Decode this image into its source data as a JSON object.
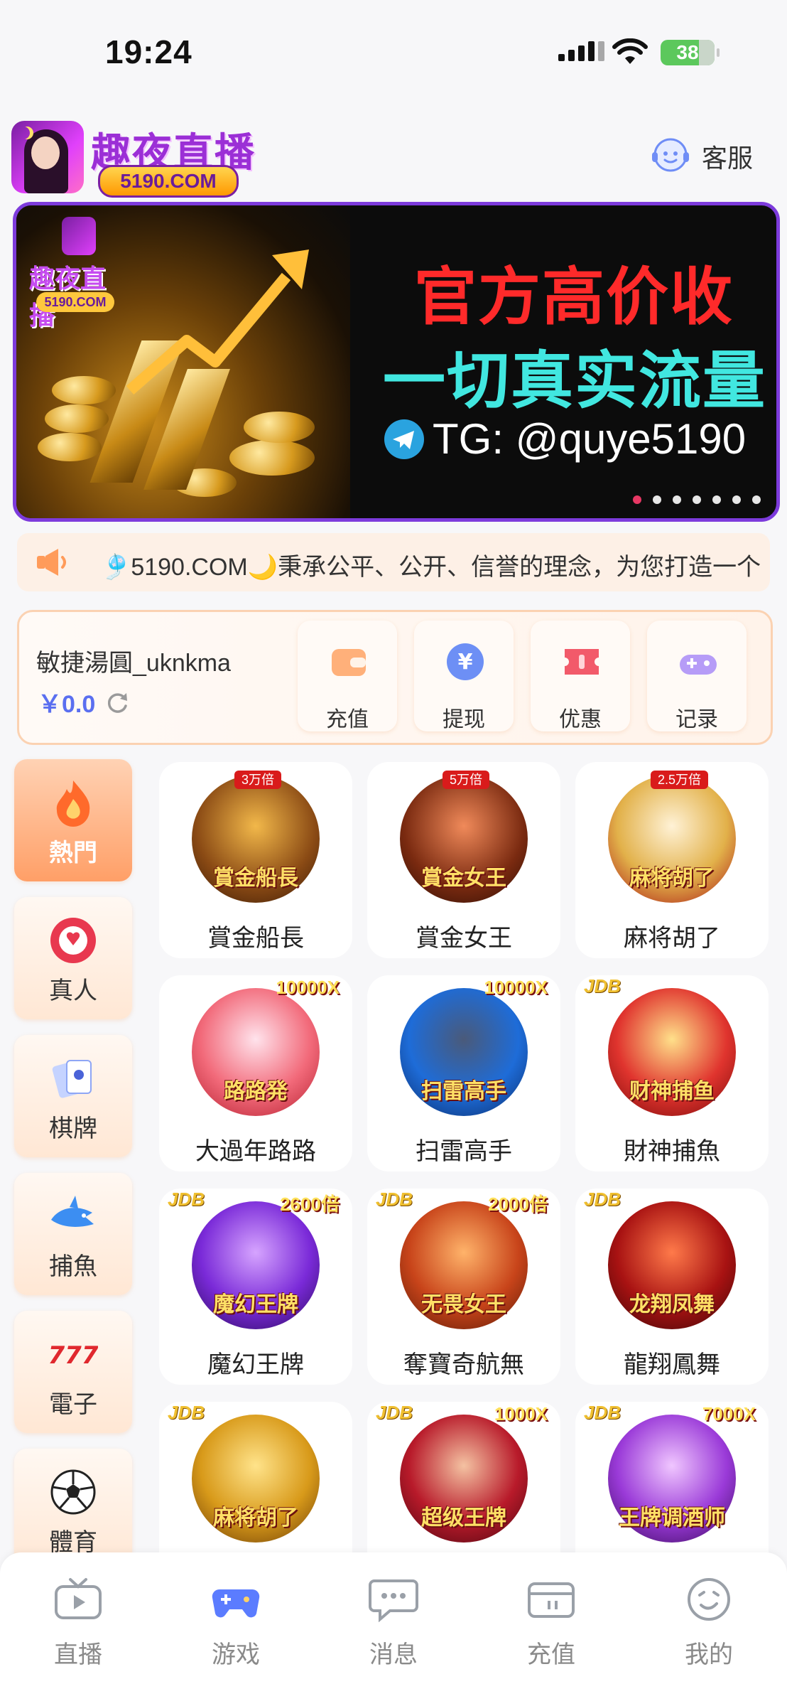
{
  "status_bar": {
    "time": "19:24",
    "battery": "38"
  },
  "header": {
    "logo_title": "趣夜直播",
    "logo_domain": "5190.COM",
    "service_label": "客服"
  },
  "banner": {
    "logo_title": "趣夜直播",
    "logo_domain": "5190.COM",
    "line1": "官方高价收",
    "line2": "一切真实流量",
    "telegram": "TG: @quye5190",
    "slide_count": 7,
    "active_slide": 0
  },
  "marquee": {
    "text": "🎐5190.COM🌙秉承公平、公开、信誉的理念，为您打造一个"
  },
  "account": {
    "username": "敏捷湯圓_uknkma",
    "balance": "￥0.0",
    "actions": [
      {
        "label": "充值",
        "icon": "wallet-icon"
      },
      {
        "label": "提现",
        "icon": "yuan-coin-icon"
      },
      {
        "label": "优惠",
        "icon": "ticket-icon"
      },
      {
        "label": "记录",
        "icon": "gamepad-icon"
      }
    ]
  },
  "categories": [
    {
      "label": "熱門",
      "icon": "fire-icon",
      "active": true
    },
    {
      "label": "真人",
      "icon": "poker-chip-icon",
      "active": false
    },
    {
      "label": "棋牌",
      "icon": "playing-cards-icon",
      "active": false
    },
    {
      "label": "捕魚",
      "icon": "shark-icon",
      "active": false
    },
    {
      "label": "電子",
      "icon": "slot-777-icon",
      "active": false
    },
    {
      "label": "體育",
      "icon": "soccer-ball-icon",
      "active": false
    }
  ],
  "games": [
    {
      "name": "賞金船長",
      "badge": "3万倍",
      "art_text": "賞金船長"
    },
    {
      "name": "賞金女王",
      "badge": "5万倍",
      "art_text": "賞金女王"
    },
    {
      "name": "麻将胡了",
      "badge": "2.5万倍",
      "art_text": "麻将胡了"
    },
    {
      "name": "大過年路路",
      "mult": "10000X",
      "art_text": "路路発"
    },
    {
      "name": "扫雷高手",
      "mult": "10000X",
      "art_text": "扫雷高手"
    },
    {
      "name": "財神捕魚",
      "jdb": "JDB",
      "art_text": "财神捕鱼"
    },
    {
      "name": "魔幻王牌",
      "jdb": "JDB",
      "mult": "2600倍",
      "art_text": "魔幻王牌"
    },
    {
      "name": "奪寶奇航無",
      "jdb": "JDB",
      "mult": "2000倍",
      "art_text": "无畏女王"
    },
    {
      "name": "龍翔鳳舞",
      "jdb": "JDB",
      "art_text": "龙翔凤舞"
    },
    {
      "name": "",
      "jdb": "JDB",
      "art_text": "麻将胡了"
    },
    {
      "name": "",
      "jdb": "JDB",
      "mult": "1000X",
      "art_text": "超级王牌"
    },
    {
      "name": "",
      "jdb": "JDB",
      "mult": "7000X",
      "art_text": "王牌调酒师"
    }
  ],
  "tabbar": [
    {
      "label": "直播",
      "icon": "tv-icon",
      "active": false
    },
    {
      "label": "游戏",
      "icon": "gamepad-icon",
      "active": true
    },
    {
      "label": "消息",
      "icon": "chat-bubble-icon",
      "active": false
    },
    {
      "label": "充值",
      "icon": "card-icon",
      "active": false
    },
    {
      "label": "我的",
      "icon": "smiley-icon",
      "active": false
    }
  ],
  "colors": {
    "accent": "#ff8a4c",
    "brand_purple": "#7d3bdc",
    "balance_blue": "#5a6ff0",
    "tab_active": "#5b7cff"
  }
}
